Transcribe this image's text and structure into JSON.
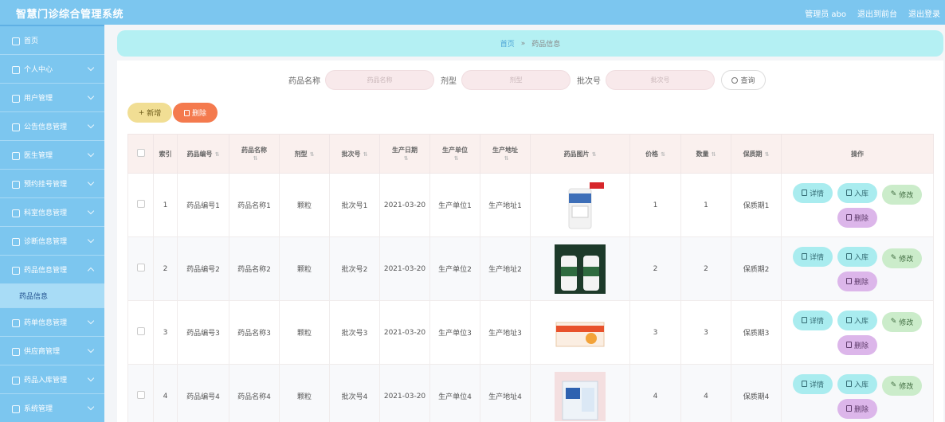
{
  "app": {
    "title": "智慧门诊综合管理系统"
  },
  "topbar": {
    "admin": "管理员 abo",
    "to_home": "退出到前台",
    "logout": "退出登录"
  },
  "sidebar": {
    "items": [
      {
        "label": "首页",
        "icon": "home-icon"
      },
      {
        "label": "个人中心",
        "icon": "user-icon"
      },
      {
        "label": "用户管理",
        "icon": "users-icon"
      },
      {
        "label": "公告信息管理",
        "icon": "notice-icon"
      },
      {
        "label": "医生管理",
        "icon": "doctor-icon"
      },
      {
        "label": "预约挂号管理",
        "icon": "calendar-icon"
      },
      {
        "label": "科室信息管理",
        "icon": "chat-icon"
      },
      {
        "label": "诊断信息管理",
        "icon": "diagnosis-icon"
      },
      {
        "label": "药品信息管理",
        "icon": "pill-icon",
        "open": true
      },
      {
        "label": "药单信息管理",
        "icon": "send-icon"
      },
      {
        "label": "供应商管理",
        "icon": "clock-icon"
      },
      {
        "label": "药品入库管理",
        "icon": "warehouse-icon"
      },
      {
        "label": "系统管理",
        "icon": "settings-icon"
      }
    ],
    "sub_item": "药品信息"
  },
  "breadcrumb": {
    "home": "首页",
    "separator": "»",
    "current": "药品信息"
  },
  "search": {
    "name_label": "药品名称",
    "name_placeholder": "药品名称",
    "form_label": "剂型",
    "form_placeholder": "剂型",
    "batch_label": "批次号",
    "batch_placeholder": "批次号",
    "query": "查询"
  },
  "toolbar": {
    "add": "新增",
    "delete": "删除"
  },
  "table": {
    "headers": [
      "索引",
      "药品编号",
      "药品名称",
      "剂型",
      "批次号",
      "生产日期",
      "生产单位",
      "生产地址",
      "药品图片",
      "价格",
      "数量",
      "保质期",
      "操作"
    ],
    "rows": [
      {
        "index": "1",
        "code": "药品编号1",
        "name": "药品名称1",
        "form": "颗粒",
        "batch": "批次号1",
        "date": "2021-03-20",
        "unit": "生产单位1",
        "addr": "生产地址1",
        "price": "1",
        "qty": "1",
        "shelf": "保质期1"
      },
      {
        "index": "2",
        "code": "药品编号2",
        "name": "药品名称2",
        "form": "颗粒",
        "batch": "批次号2",
        "date": "2021-03-20",
        "unit": "生产单位2",
        "addr": "生产地址2",
        "price": "2",
        "qty": "2",
        "shelf": "保质期2"
      },
      {
        "index": "3",
        "code": "药品编号3",
        "name": "药品名称3",
        "form": "颗粒",
        "batch": "批次号3",
        "date": "2021-03-20",
        "unit": "生产单位3",
        "addr": "生产地址3",
        "price": "3",
        "qty": "3",
        "shelf": "保质期3"
      },
      {
        "index": "4",
        "code": "药品编号4",
        "name": "药品名称4",
        "form": "颗粒",
        "batch": "批次号4",
        "date": "2021-03-20",
        "unit": "生产单位4",
        "addr": "生产地址4",
        "price": "4",
        "qty": "4",
        "shelf": "保质期4"
      }
    ],
    "ops": {
      "detail": "详情",
      "stock_in": "入库",
      "edit": "修改",
      "delete": "删除"
    }
  },
  "colors": {
    "topbar": "#7cc6ef",
    "breadcrumb": "#b4f0f3",
    "add": "#f1de94",
    "delete": "#f47a4e"
  }
}
